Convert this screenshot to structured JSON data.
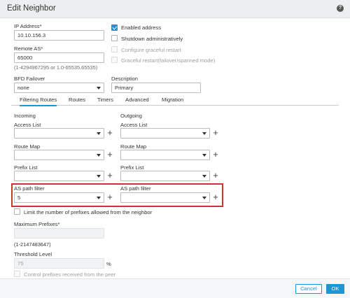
{
  "dialog": {
    "title": "Edit Neighbor",
    "help_icon": "?"
  },
  "left": {
    "ip_label": "IP Address*",
    "ip_value": "10.10.156.3",
    "remote_as_label": "Remote AS*",
    "remote_as_value": "65000",
    "remote_as_hint": "(1-4294967295 or 1.0-65535.65535)",
    "bfd_label": "BFD Failover",
    "bfd_value": "none"
  },
  "right": {
    "enabled_address": "Enabled address",
    "shutdown": "Shutdown administratively",
    "graceful_restart": "Configure graceful restart",
    "graceful_restart_failover": "Graceful restart(failover/spanned mode)",
    "description_label": "Description",
    "description_value": "Primary"
  },
  "tabs": [
    "Filtering Routes",
    "Routes",
    "Timers",
    "Advanced",
    "Migration"
  ],
  "filtering": {
    "incoming_label": "Incoming",
    "outgoing_label": "Outgoing",
    "access_list_in": "Access List",
    "access_list_out": "Access List",
    "route_map_in": "Route Map",
    "route_map_out": "Route Map",
    "prefix_list_in": "Prefix List",
    "prefix_list_out": "Prefix List",
    "as_path_in": "AS path filter",
    "as_path_in_value": "5",
    "as_path_out": "AS path filter",
    "plus": "+"
  },
  "prefix_limit": {
    "limit_label": "Limit the number of prefixes allowed from the neighbor",
    "max_prefixes_label": "Maximum Prefixes*",
    "max_prefixes_hint": "(1-2147483647)",
    "threshold_label": "Threshold Level",
    "threshold_value": "75",
    "threshold_unit": "%",
    "control_label": "Control prefixes received from the peer"
  },
  "footer": {
    "cancel": "Cancel",
    "ok": "OK"
  },
  "colors": {
    "accent": "#1e96d6",
    "highlight": "#c8392b"
  }
}
